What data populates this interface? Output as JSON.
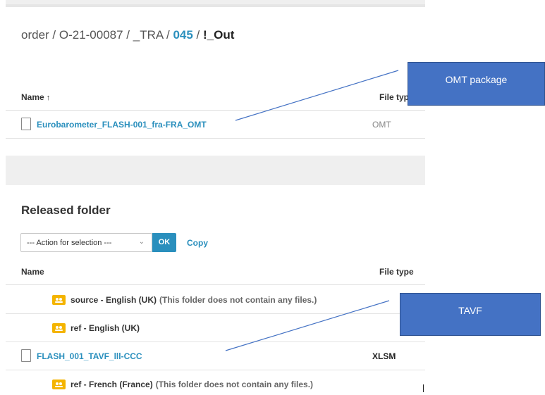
{
  "breadcrumb": {
    "part1": "order / O-21-00087 / _TRA / ",
    "link": "045",
    "sep": " / ",
    "current": "!_Out"
  },
  "out_table": {
    "col_name": "Name",
    "col_type": "File typ",
    "sort_arrow": "↑",
    "rows": [
      {
        "name": "Eurobarometer_FLASH-001_fra-FRA_OMT",
        "type": "OMT"
      }
    ]
  },
  "released": {
    "title": "Released folder",
    "action_select": "--- Action for selection ---",
    "ok_label": "OK",
    "copy_label": "Copy",
    "col_name": "Name",
    "col_type": "File type",
    "rows": [
      {
        "name": "source - English (UK)",
        "note": "(This folder does not contain any files.)"
      },
      {
        "name": "ref - English (UK)",
        "note": ""
      },
      {
        "name": "FLASH_001_TAVF_lll-CCC",
        "type": "XLSM"
      },
      {
        "name": "ref - French (France)",
        "note": "(This folder does not contain any files.)"
      }
    ]
  },
  "callouts": {
    "omt": "OMT package",
    "tavf": "TAVF"
  },
  "colors": {
    "link": "#2a8fbd",
    "callout": "#4472c4",
    "folder": "#f4b400"
  },
  "icons": [
    "file-icon",
    "folder-icon",
    "chevron-down-icon",
    "sort-arrow-up-icon"
  ]
}
